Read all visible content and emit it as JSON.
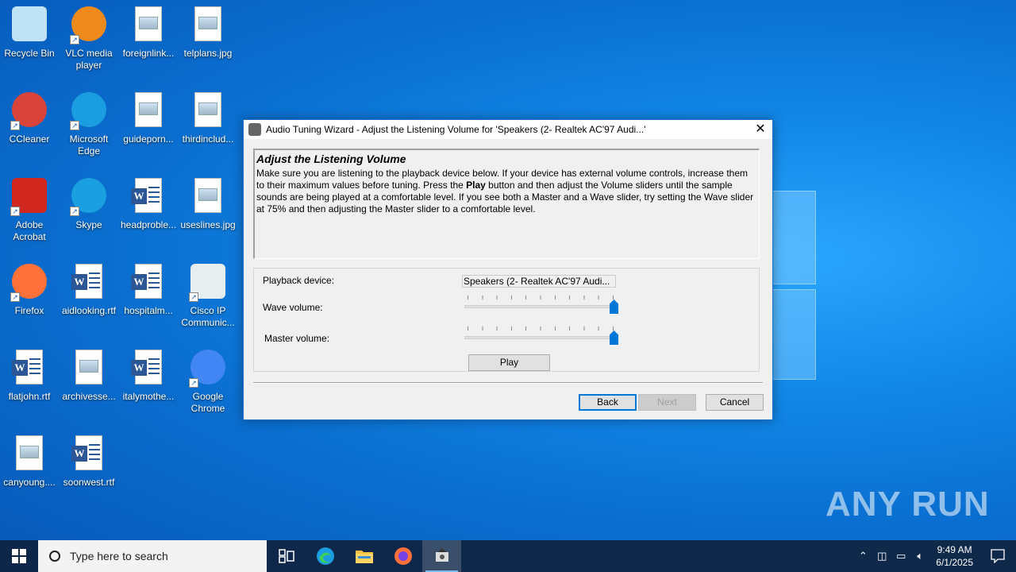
{
  "desktop": {
    "icons": [
      {
        "label": "Recycle Bin"
      },
      {
        "label": "VLC media player"
      },
      {
        "label": "foreignlink..."
      },
      {
        "label": "telplans.jpg"
      },
      {
        "label": "CCleaner"
      },
      {
        "label": "Microsoft Edge"
      },
      {
        "label": "guideporn..."
      },
      {
        "label": "thirdinclud..."
      },
      {
        "label": "Adobe Acrobat"
      },
      {
        "label": "Skype"
      },
      {
        "label": "headproble..."
      },
      {
        "label": "useslines.jpg"
      },
      {
        "label": "Firefox"
      },
      {
        "label": "aidlooking.rtf"
      },
      {
        "label": "hospitalm..."
      },
      {
        "label": "Cisco IP Communic..."
      },
      {
        "label": "flatjohn.rtf"
      },
      {
        "label": "archivesse..."
      },
      {
        "label": "italymothe..."
      },
      {
        "label": "Google Chrome"
      },
      {
        "label": "canyoung...."
      },
      {
        "label": "soonwest.rtf"
      }
    ]
  },
  "dialog": {
    "title": "Audio Tuning Wizard - Adjust the Listening Volume for 'Speakers (2- Realtek AC'97 Audi...'",
    "close_glyph": "✕",
    "heading": "Adjust the Listening Volume",
    "desc_part1": "Make sure you are listening to the playback device below. If your device has external volume controls, increase them to their maximum values before tuning. Press the ",
    "desc_bold": "Play",
    "desc_part2": " button and then adjust the Volume sliders until the sample sounds are being played at a comfortable level. If you see both a Master and a Wave slider, try setting the Wave slider at 75% and then adjusting the Master slider to a comfortable level.",
    "playback_label": "Playback device:",
    "playback_value": "Speakers (2- Realtek AC'97 Audi...",
    "wave_label": "Wave volume:",
    "wave_value": 1.0,
    "master_label": "Master volume:",
    "master_value": 1.0,
    "play_button": "Play",
    "back_button": "Back",
    "next_button": "Next",
    "cancel_button": "Cancel"
  },
  "taskbar": {
    "search_placeholder": "Type here to search",
    "time": "9:49 AM",
    "date": "6/1/2025"
  },
  "watermark": "ANY RUN",
  "colors": {
    "accent": "#0078d7",
    "desktop": "#0a6fd0"
  }
}
